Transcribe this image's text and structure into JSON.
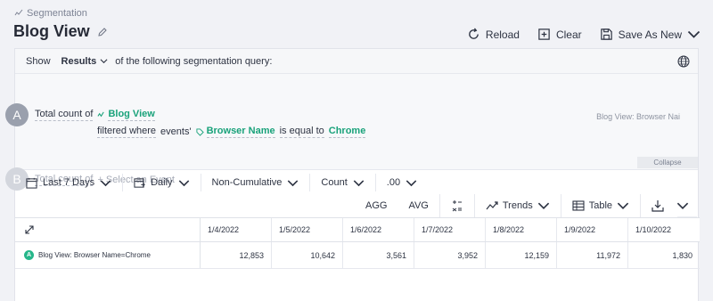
{
  "header": {
    "breadcrumb": "Segmentation",
    "title": "Blog View",
    "actions": {
      "reload": "Reload",
      "clear": "Clear",
      "save": "Save As New"
    }
  },
  "show_bar": {
    "show": "Show",
    "selected": "Results",
    "suffix": "of the following segmentation query:"
  },
  "query": {
    "a_badge": "A",
    "a_total": "Total count of",
    "a_event": "Blog View",
    "filtered": "filtered where",
    "events_word": "events'",
    "property": "Browser Name",
    "operator": "is equal to",
    "value": "Chrome",
    "right_note": "Blog View: Browser Nai",
    "b_badge": "B",
    "b_total": "Total count of",
    "b_placeholder": "Select an Event",
    "collapse": "Collapse"
  },
  "controls": {
    "range": "Last 7 Days",
    "interval": "Daily",
    "mode": "Non-Cumulative",
    "measure": "Count",
    "decimals": ".00"
  },
  "toolbar2": {
    "agg": "AGG",
    "avg": "AVG",
    "trends": "Trends",
    "table": "Table"
  },
  "table": {
    "headers": [
      "1/4/2022",
      "1/5/2022",
      "1/6/2022",
      "1/7/2022",
      "1/8/2022",
      "1/9/2022",
      "1/10/2022"
    ],
    "row_badge": "A",
    "row_label": "Blog View: Browser Name=Chrome",
    "values": [
      "12,853",
      "10,642",
      "3,561",
      "3,952",
      "12,159",
      "11,972",
      "1,830"
    ]
  }
}
